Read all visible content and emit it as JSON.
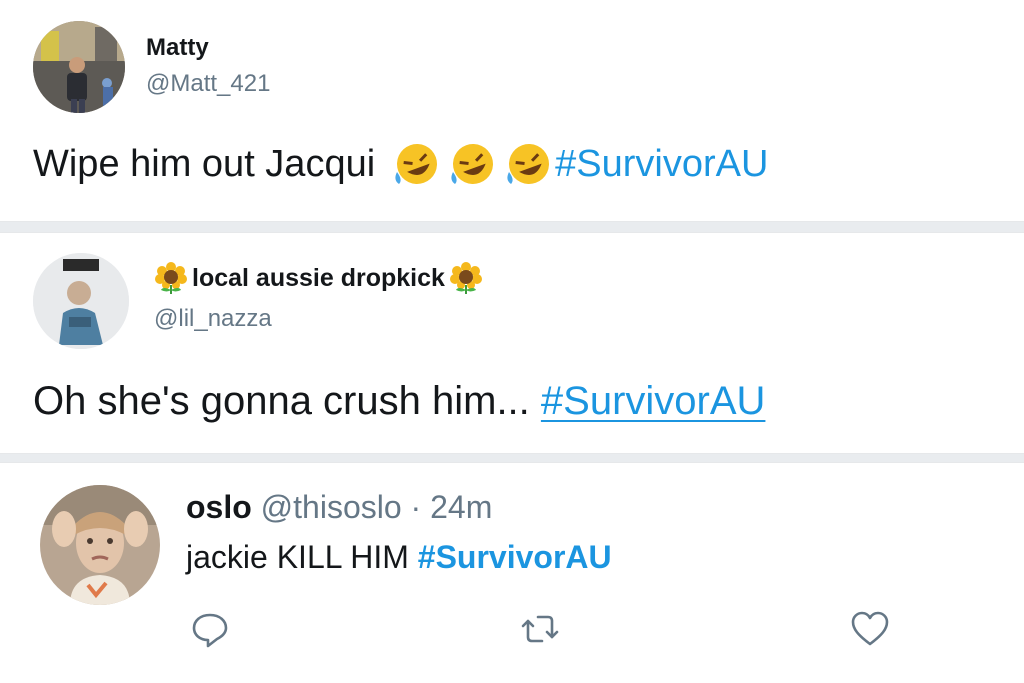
{
  "tweets": [
    {
      "name": "Matty",
      "handle": "@Matt_421",
      "text": "Wipe him out Jacqui",
      "emoji": [
        "rofl-icon",
        "rofl-icon",
        "rofl-icon"
      ],
      "hashtag": "#SurvivorAU"
    },
    {
      "name": "local aussie dropkick",
      "name_emoji": "sunflower-icon",
      "handle": "@lil_nazza",
      "text": "Oh she's gonna crush him...",
      "hashtag": "#SurvivorAU"
    },
    {
      "name": "oslo",
      "handle": "@thisoslo",
      "separator": "·",
      "time": "24m",
      "text": "jackie KILL HIM",
      "hashtag": "#SurvivorAU",
      "actions": [
        "reply-icon",
        "retweet-icon",
        "like-icon"
      ]
    }
  ],
  "colors": {
    "hashtag": "#1b95e0",
    "secondary_text": "#657786",
    "background": "#e9ecef"
  }
}
